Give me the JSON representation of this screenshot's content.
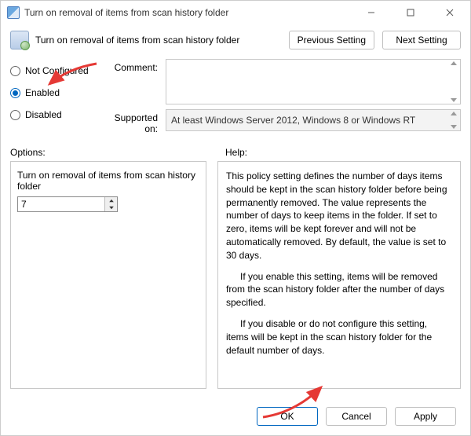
{
  "titlebar": {
    "title": "Turn on removal of items from scan history folder"
  },
  "header": {
    "title": "Turn on removal of items from scan history folder",
    "prev": "Previous Setting",
    "next": "Next Setting"
  },
  "radios": {
    "not_configured": "Not Configured",
    "enabled": "Enabled",
    "disabled": "Disabled",
    "selected": "enabled"
  },
  "labels": {
    "comment": "Comment:",
    "supported": "Supported on:",
    "options": "Options:",
    "help": "Help:"
  },
  "supported": {
    "text": "At least Windows Server 2012, Windows 8 or Windows RT"
  },
  "options": {
    "setting_label": "Turn on removal of items from scan history folder",
    "value": "7"
  },
  "help": {
    "p1": "This policy setting defines the number of days items should be kept in the scan history folder before being permanently removed. The value represents the number of days to keep items in the folder. If set to zero, items will be kept forever and will not be automatically removed. By default, the value is set to 30 days.",
    "p2": "If you enable this setting, items will be removed from the scan history folder after the number of days specified.",
    "p3": "If you disable or do not configure this setting, items will be kept in the scan history folder for the default number of days."
  },
  "footer": {
    "ok": "OK",
    "cancel": "Cancel",
    "apply": "Apply"
  }
}
